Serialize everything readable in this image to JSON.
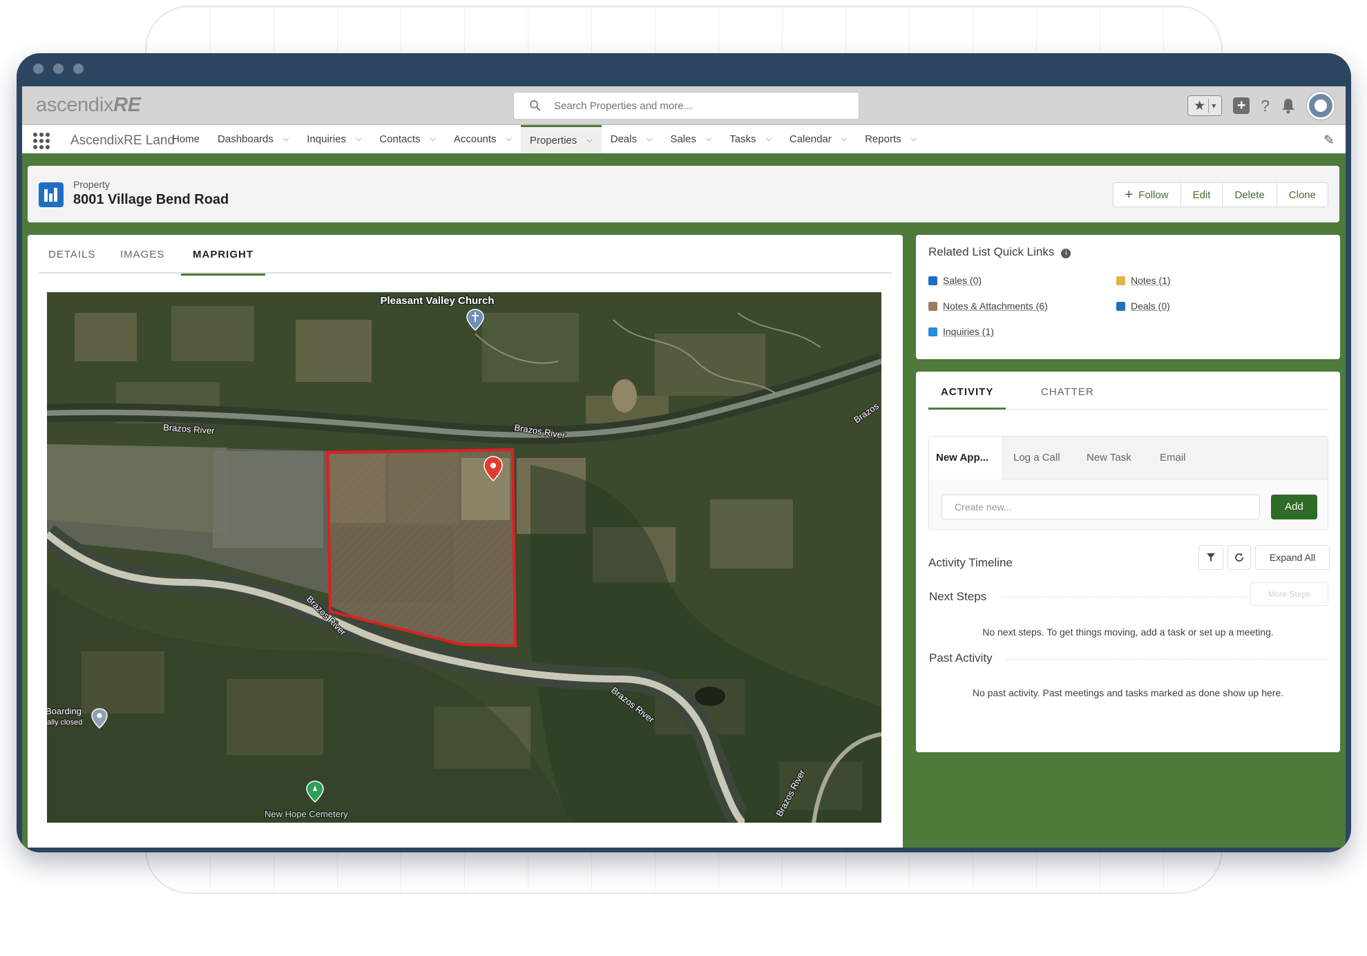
{
  "app": {
    "logo_light": "ascendix",
    "logo_bold": "RE",
    "search_placeholder": "Search Properties and more...",
    "app_name": "AscendixRE Land"
  },
  "nav": {
    "items": [
      {
        "label": "Home",
        "dropdown": false
      },
      {
        "label": "Dashboards",
        "dropdown": true
      },
      {
        "label": "Inquiries",
        "dropdown": true
      },
      {
        "label": "Contacts",
        "dropdown": true
      },
      {
        "label": "Accounts",
        "dropdown": true
      },
      {
        "label": "Properties",
        "dropdown": true,
        "active": true
      },
      {
        "label": "Deals",
        "dropdown": true
      },
      {
        "label": "Sales",
        "dropdown": true
      },
      {
        "label": "Tasks",
        "dropdown": true
      },
      {
        "label": "Calendar",
        "dropdown": true
      },
      {
        "label": "Reports",
        "dropdown": true
      }
    ]
  },
  "record": {
    "object_label": "Property",
    "title": "8001 Village Bend Road",
    "buttons": {
      "follow": "Follow",
      "edit": "Edit",
      "delete": "Delete",
      "clone": "Clone"
    }
  },
  "tabs": {
    "details": "DETAILS",
    "images": "IMAGES",
    "mapright": "MAPRIGHT",
    "active": "MAPRIGHT"
  },
  "map": {
    "labels": {
      "church": "Pleasant Valley Church",
      "river1": "Brazos River",
      "river2": "Brazos River",
      "river3": "Brazos",
      "river4": "Brazos River",
      "river5": "Brazos River",
      "river6": "Brazos River",
      "boarding1": "Boarding",
      "boarding2": "ally closed",
      "cemetery": "New Hope Cemetery"
    }
  },
  "quick_links": {
    "title": "Related List Quick Links",
    "items": [
      {
        "label": "Sales (0)",
        "color": "#1e6fc4"
      },
      {
        "label": "Notes (1)",
        "color": "#e3b44a"
      },
      {
        "label": "Notes & Attachments (6)",
        "color": "#9a7b5e"
      },
      {
        "label": "Deals (0)",
        "color": "#1e6fc4"
      },
      {
        "label": "Inquiries (1)",
        "color": "#2a8bd6"
      }
    ]
  },
  "activity": {
    "tabs": {
      "activity": "ACTIVITY",
      "chatter": "CHATTER"
    },
    "publisher_tabs": [
      "New App...",
      "Log a Call",
      "New Task",
      "Email"
    ],
    "create_placeholder": "Create new...",
    "add_label": "Add",
    "timeline_label": "Activity Timeline",
    "expand_all": "Expand All",
    "next_steps": "Next Steps",
    "more_steps": "More Steps",
    "next_steps_empty": "No next steps. To get things moving, add a task or set up a meeting.",
    "past_activity": "Past Activity",
    "past_activity_empty": "No past activity. Past meetings and tasks marked as done show up here."
  },
  "colors": {
    "brand_green": "#4e7a3a",
    "add_button": "#2e6b26",
    "frame": "#2c4560",
    "record_icon": "#1e6fc4",
    "boundary": "#e01e24"
  }
}
